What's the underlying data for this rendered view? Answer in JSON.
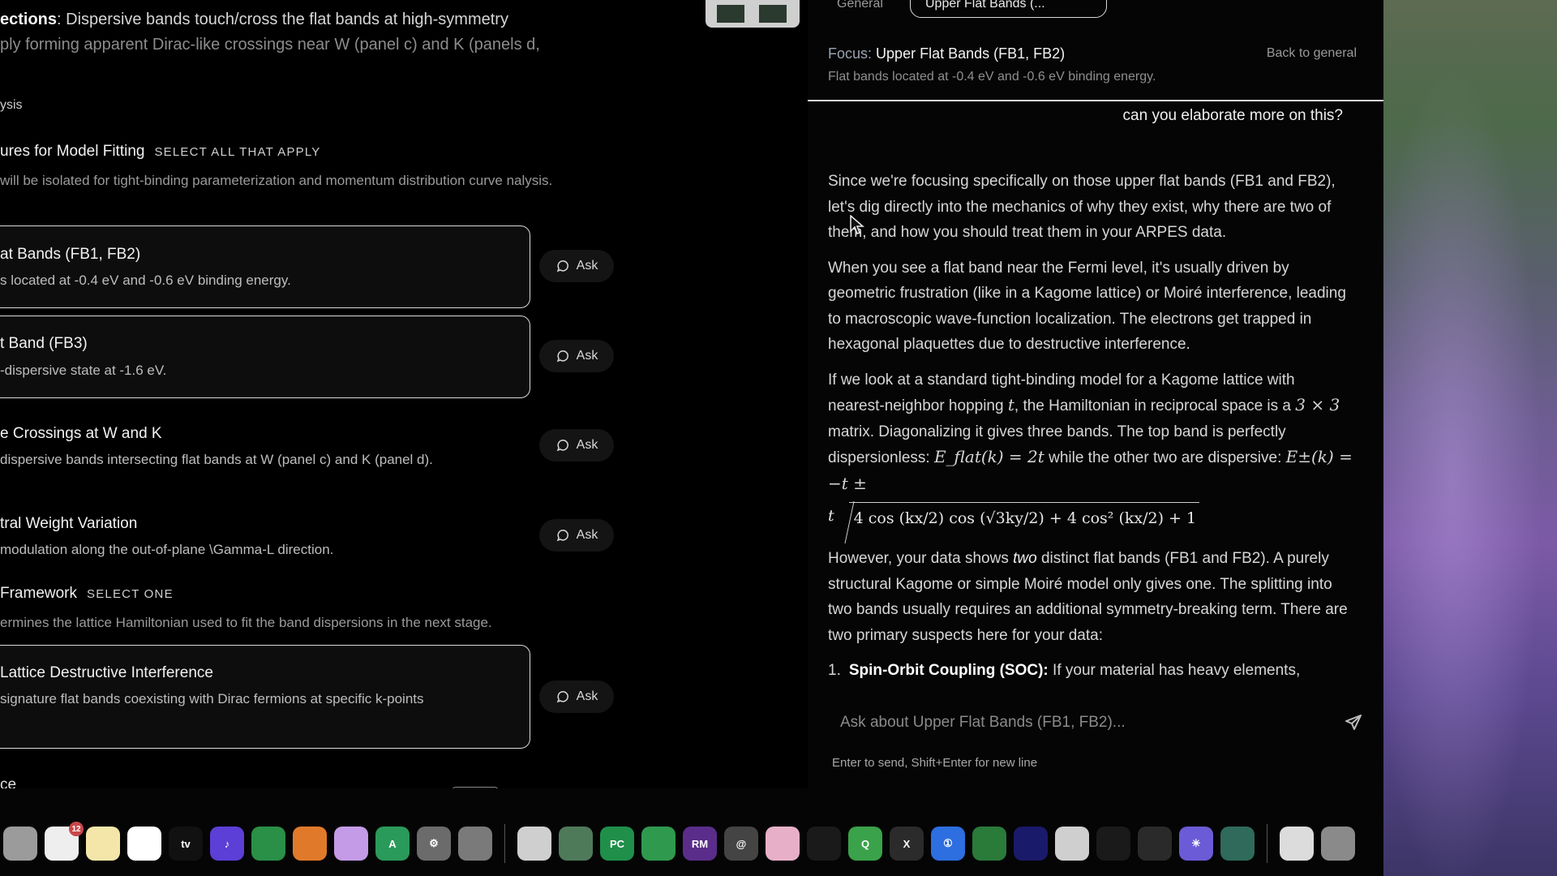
{
  "left": {
    "intro_line_1_bold": "ections",
    "intro_line_1_rest": ": Dispersive bands touch/cross the flat bands at high-symmetry",
    "intro_line_2": "ply forming apparent Dirac-like crossings near W (panel c) and K (panels d,",
    "analysis_label": "ysis",
    "features": {
      "title": "ures for Model Fitting",
      "tag": "SELECT ALL THAT APPLY",
      "desc": "will be isolated for tight-binding parameterization and momentum distribution curve nalysis.",
      "options": [
        {
          "title": "at Bands (FB1, FB2)",
          "desc": "s located at -0.4 eV and -0.6 eV binding energy.",
          "ask": "Ask"
        },
        {
          "title": "t Band (FB3)",
          "desc": "-dispersive state at -1.6 eV.",
          "ask": "Ask"
        },
        {
          "title": "e Crossings at W and K",
          "desc": "dispersive bands intersecting flat bands at W (panel c) and K (panel d).",
          "ask": "Ask"
        },
        {
          "title": "tral Weight Variation",
          "desc": "modulation along the out-of-plane \\Gamma-L direction.",
          "ask": "Ask"
        }
      ]
    },
    "framework": {
      "title": "Framework",
      "tag": "SELECT ONE",
      "desc": "ermines the lattice Hamiltonian used to fit the band dispersions in the next stage.",
      "options": [
        {
          "title": "Lattice Destructive Interference",
          "desc": "signature flat bands coexisting with Dirac fermions at specific k-points",
          "ask": "Ask"
        }
      ]
    },
    "cut_text": "ce"
  },
  "chat": {
    "tabs": [
      "General",
      "Upper Flat Bands (..."
    ],
    "focus_label": "Focus:",
    "focus_value": "Upper Flat Bands (FB1, FB2)",
    "back_link": "Back to general",
    "focus_sub": "Flat bands located at -0.4 eV and -0.6 eV binding energy.",
    "user_message": "can you elaborate more on this?",
    "p1": "Since we're focusing specifically on those upper flat bands (FB1 and FB2), let's dig directly into the mechanics of why they exist, why there are two of them, and how you should treat them in your ARPES data.",
    "p2": "When you see a flat band near the Fermi level, it's usually driven by geometric frustration (like in a Kagome lattice) or Moiré interference, leading to macroscopic wave-function localization. The electrons get trapped in hexagonal plaquettes due to destructive interference.",
    "p3_a": "If we look at a standard tight-binding model for a Kagome lattice with nearest-neighbor hopping ",
    "p3_t": "t",
    "p3_b": ", the Hamiltonian in reciprocal space is a ",
    "p3_matrix": "3 × 3",
    "p3_c": " matrix. Diagonalizing it gives three bands. The top band is perfectly dispersionless: ",
    "p3_eflat": "E_flat(k) = 2t",
    "p3_d": " while the other two are dispersive: ",
    "p3_epm": "E±(k) = −t ±",
    "formula_prefix": "t",
    "formula_body": "4 cos (kx/2) cos (√3ky/2) + 4 cos² (kx/2) + 1",
    "p4_a": "However, your data shows ",
    "p4_em": "two",
    "p4_b": " distinct flat bands (FB1 and FB2). A purely structural Kagome or simple Moiré model only gives one. The splitting into two bands usually requires an additional symmetry-breaking term. There are two primary suspects here for your data:",
    "list_num": "1.",
    "list_bold": "Spin-Orbit Coupling (SOC):",
    "list_rest": " If your material has heavy elements,",
    "input_placeholder": "Ask about Upper Flat Bands (FB1, FB2)...",
    "hint": "Enter to send, Shift+Enter for new line"
  },
  "dock": {
    "icons": [
      {
        "name": "contacts-icon",
        "color": "#9b9b9b",
        "label": ""
      },
      {
        "name": "reminders-icon",
        "color": "#eeeeee",
        "label": "",
        "badge": "12"
      },
      {
        "name": "notes-icon",
        "color": "#f3e6a8",
        "label": ""
      },
      {
        "name": "freeform-icon",
        "color": "#ffffff",
        "label": ""
      },
      {
        "name": "apple-tv-icon",
        "color": "#111111",
        "label": "tv"
      },
      {
        "name": "music-icon",
        "color": "#5b3fd6",
        "label": "♪"
      },
      {
        "name": "keynote-icon",
        "color": "#2a8f47",
        "label": ""
      },
      {
        "name": "numbers-icon",
        "color": "#e07a2a",
        "label": ""
      },
      {
        "name": "pages-icon",
        "color": "#c49be6",
        "label": ""
      },
      {
        "name": "app-store-icon",
        "color": "#2a9a5a",
        "label": "A"
      },
      {
        "name": "system-settings-icon",
        "color": "#6b6b6b",
        "label": "⚙"
      },
      {
        "name": "iphone-mirroring-icon",
        "color": "#7a7a7a",
        "label": ""
      },
      {
        "name": "sep",
        "color": "",
        "label": ""
      },
      {
        "name": "feather-icon",
        "color": "#cfcfcf",
        "label": ""
      },
      {
        "name": "preview-icon",
        "color": "#4f7a5a",
        "label": ""
      },
      {
        "name": "pycharm-icon",
        "color": "#1f8f4a",
        "label": "PC"
      },
      {
        "name": "overleaf-icon",
        "color": "#2f9a4e",
        "label": ""
      },
      {
        "name": "rubymine-icon",
        "color": "#5a2d8a",
        "label": "RM"
      },
      {
        "name": "spiral-icon",
        "color": "#444444",
        "label": "@"
      },
      {
        "name": "cleanmymac-icon",
        "color": "#e8b0c8",
        "label": ""
      },
      {
        "name": "activity-monitor-icon",
        "color": "#1a1a1a",
        "label": ""
      },
      {
        "name": "qt-icon",
        "color": "#3aa24a",
        "label": "Q"
      },
      {
        "name": "xcode-icon",
        "color": "#2b2b2b",
        "label": "X"
      },
      {
        "name": "onepassword-icon",
        "color": "#2d6ee0",
        "label": "①"
      },
      {
        "name": "docker-icon",
        "color": "#2a7a3a",
        "label": ""
      },
      {
        "name": "acrobat-icon",
        "color": "#1a1a6a",
        "label": ""
      },
      {
        "name": "chrome-icon",
        "color": "#cfcfcf",
        "label": ""
      },
      {
        "name": "audio-icon",
        "color": "#1a1a1a",
        "label": ""
      },
      {
        "name": "terminal-icon",
        "color": "#2a2a2a",
        "label": ""
      },
      {
        "name": "perplexity-icon",
        "color": "#6b5bd6",
        "label": "✳"
      },
      {
        "name": "altstore-icon",
        "color": "#2f6a5a",
        "label": ""
      },
      {
        "name": "sep",
        "color": "",
        "label": ""
      },
      {
        "name": "downloads-icon",
        "color": "#dcdcdc",
        "label": ""
      },
      {
        "name": "trash-icon",
        "color": "#8a8a8a",
        "label": ""
      }
    ]
  }
}
